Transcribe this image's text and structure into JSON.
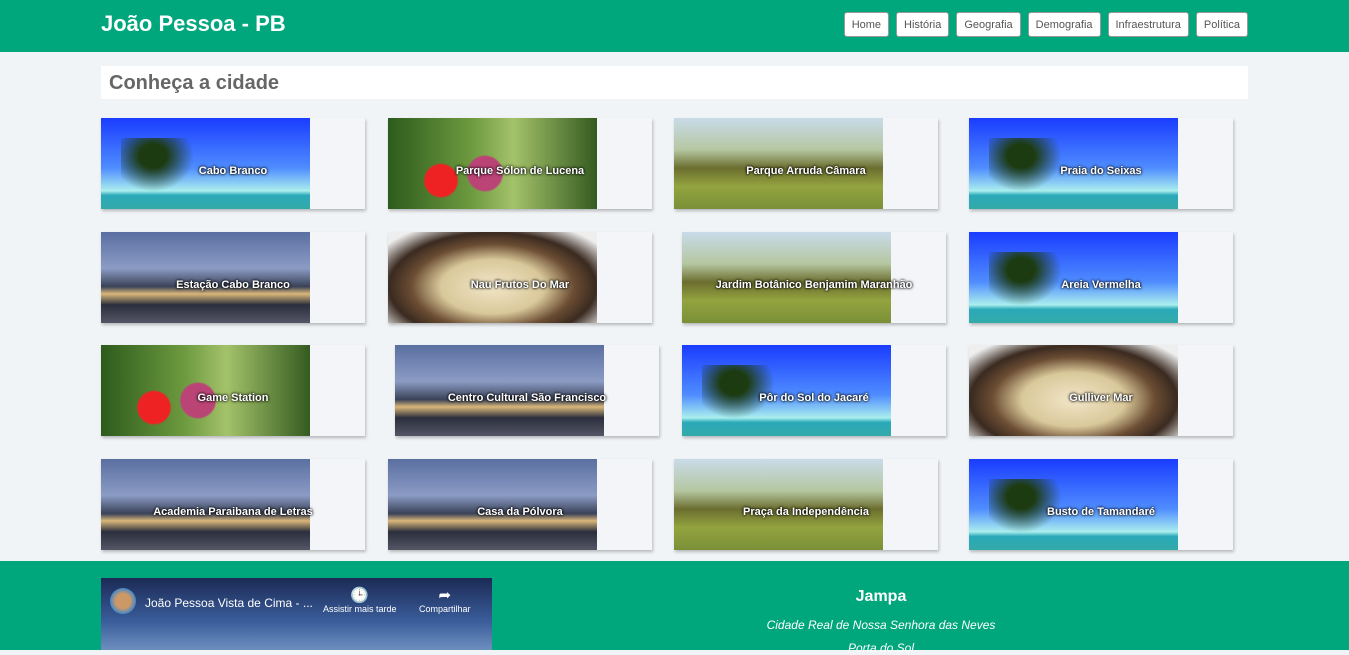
{
  "header": {
    "title": "João Pessoa - PB",
    "nav": [
      "Home",
      "História",
      "Geografia",
      "Demografia",
      "Infraestrutura",
      "Política"
    ]
  },
  "main": {
    "title": "Conheça a cidade",
    "cards": [
      {
        "label": "Cabo Branco",
        "image": "palm"
      },
      {
        "label": "Parque Sólon de Lucena",
        "image": "clown"
      },
      {
        "label": "Parque Arruda Câmara",
        "image": "park"
      },
      {
        "label": "Praia do Seixas",
        "image": "palm"
      },
      {
        "label": "Estação Cabo Branco",
        "image": "bldg"
      },
      {
        "label": "Nau Frutos Do Mar",
        "image": "food"
      },
      {
        "label": "Jardim Botânico Benjamim Maranhão",
        "image": "park"
      },
      {
        "label": "Areia Vermelha",
        "image": "palm"
      },
      {
        "label": "Game Station",
        "image": "clown"
      },
      {
        "label": "Centro Cultural São Francisco",
        "image": "bldg"
      },
      {
        "label": "Pôr do Sol do Jacaré",
        "image": "palm"
      },
      {
        "label": "Gulliver Mar",
        "image": "food"
      },
      {
        "label": "Academia Paraibana de Letras",
        "image": "bldg"
      },
      {
        "label": "Casa da Pólvora",
        "image": "bldg"
      },
      {
        "label": "Praça da Independência",
        "image": "park"
      },
      {
        "label": "Busto de Tamandaré",
        "image": "palm"
      }
    ]
  },
  "footer": {
    "video": {
      "title": "João Pessoa Vista de Cima - ...",
      "watch_later": "Assistir mais tarde",
      "share": "Compartilhar"
    },
    "title": "Jampa",
    "lines": [
      "Cidade Real de Nossa Senhora das Neves",
      "Porta do Sol"
    ]
  },
  "colors": {
    "primary": "#00a67c",
    "background": "#f1f4f7"
  }
}
